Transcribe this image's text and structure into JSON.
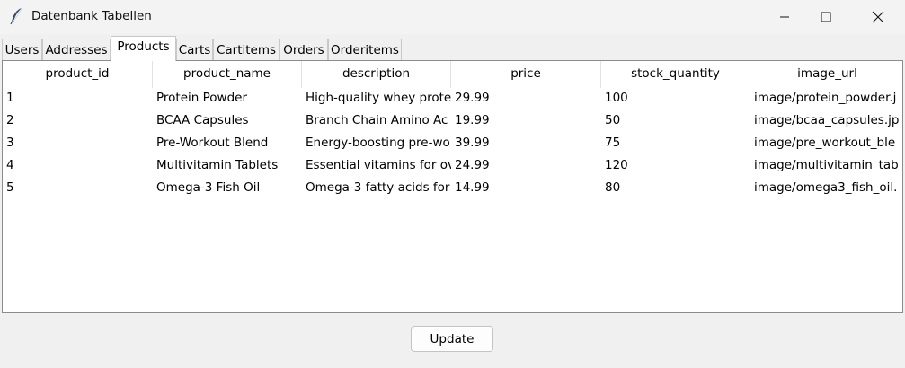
{
  "window": {
    "title": "Datenbank Tabellen"
  },
  "tabs": [
    {
      "label": "Users"
    },
    {
      "label": "Addresses"
    },
    {
      "label": "Products"
    },
    {
      "label": "Carts"
    },
    {
      "label": "Cartitems"
    },
    {
      "label": "Orders"
    },
    {
      "label": "Orderitems"
    }
  ],
  "active_tab": "Products",
  "table": {
    "columns": [
      "product_id",
      "product_name",
      "description",
      "price",
      "stock_quantity",
      "image_url"
    ],
    "rows": [
      [
        "1",
        "Protein Powder",
        "High-quality whey prote",
        "29.99",
        "100",
        "image/protein_powder.j"
      ],
      [
        "2",
        "BCAA Capsules",
        "Branch Chain Amino Ac",
        "19.99",
        "50",
        "image/bcaa_capsules.jp"
      ],
      [
        "3",
        "Pre-Workout Blend",
        "Energy-boosting pre-wo",
        "39.99",
        "75",
        "image/pre_workout_ble"
      ],
      [
        "4",
        "Multivitamin Tablets",
        "Essential vitamins for ov",
        "24.99",
        "120",
        "image/multivitamin_tab"
      ],
      [
        "5",
        "Omega-3 Fish Oil",
        "Omega-3 fatty acids for",
        "14.99",
        "80",
        "image/omega3_fish_oil."
      ]
    ]
  },
  "buttons": {
    "update": "Update"
  },
  "icons": {
    "app": "feather-icon",
    "minimize": "minimize-icon",
    "maximize": "maximize-icon",
    "close": "close-icon"
  }
}
